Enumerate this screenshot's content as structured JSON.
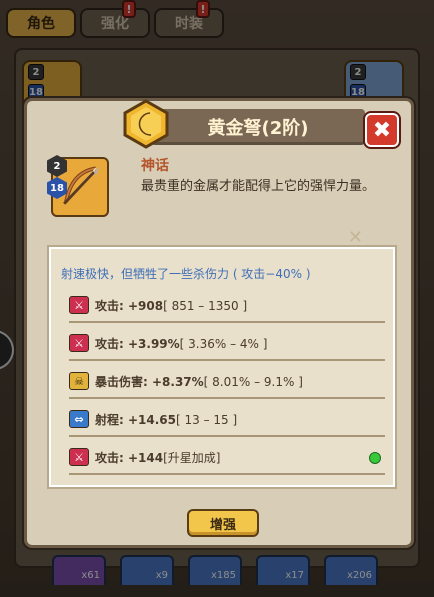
{
  "tabs": [
    {
      "label": "角色",
      "active": true
    },
    {
      "label": "强化",
      "alert": "!"
    },
    {
      "label": "时装",
      "alert": "!"
    }
  ],
  "background": {
    "slot_left": {
      "top_badge": "2",
      "bottom_badge": "18"
    },
    "slot_right": {
      "top_badge": "2",
      "bottom_badge": "18"
    },
    "bottom_items": [
      "x61",
      "x9",
      "x185",
      "x17",
      "x206"
    ]
  },
  "modal": {
    "title": "黄金弩(2阶)",
    "icon_badge_top": "2",
    "icon_badge_bottom": "18",
    "rarity": "神话",
    "description": "最贵重的金属才能配得上它的强悍力量。",
    "stats_header": "射速极快，但牺牲了一些杀伤力 ( 攻击−40% )",
    "stats": [
      {
        "icon": "attack-icon",
        "name": "攻击: ",
        "value": "+908",
        "range": "[ 851 – 1350 ]"
      },
      {
        "icon": "attack-icon",
        "name": "攻击: ",
        "value": "+3.99%",
        "range": "[ 3.36% – 4% ]"
      },
      {
        "icon": "crit-damage-icon",
        "name": "暴击伤害: ",
        "value": "+8.37%",
        "range": "[ 8.01% – 9.1% ]"
      },
      {
        "icon": "range-icon",
        "name": "射程: ",
        "value": "+14.65",
        "range": "[ 13 – 15 ]"
      },
      {
        "icon": "attack-icon",
        "name": "攻击: ",
        "value": "+144",
        "range": "[升星加成]"
      }
    ],
    "enhance_label": "增强",
    "close_symbol": "✖"
  },
  "colors": {
    "accent_gold": "#e9a93a",
    "close_red": "#d33a2c",
    "rarity": "#b4552b",
    "header_blue": "#3f6fb8"
  }
}
